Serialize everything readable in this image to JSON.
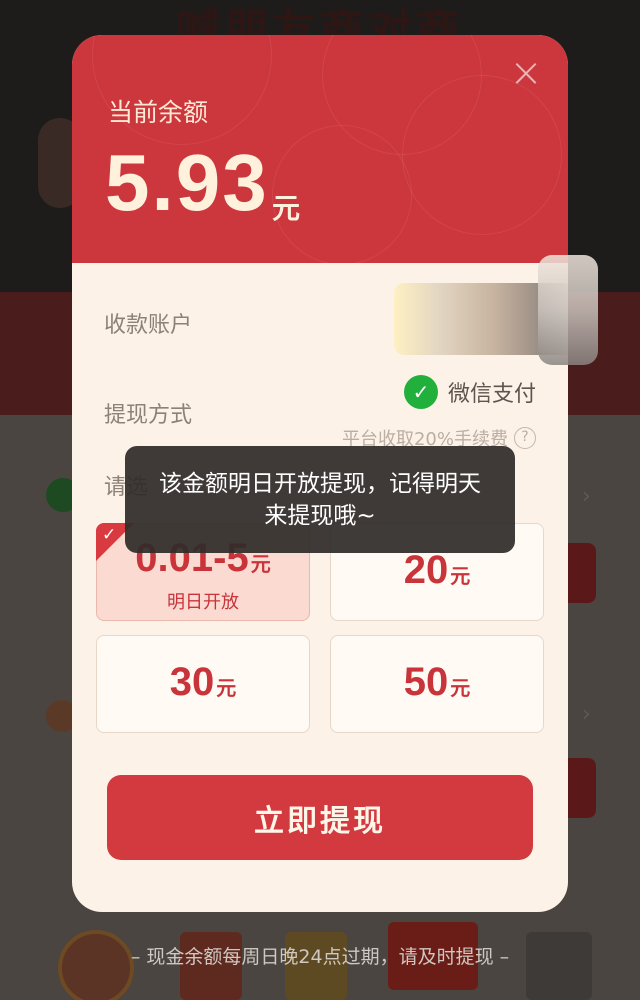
{
  "background": {
    "title": "喊朋友商对商"
  },
  "modal": {
    "balance_label": "当前余额",
    "balance_amount": "5.93",
    "balance_unit": "元",
    "close_symbol": "×",
    "account_label": "收款账户",
    "method_label": "提现方式",
    "method_value": "微信支付",
    "fee_note": "平台收取20%手续费",
    "select_label": "请选",
    "options": [
      {
        "amount": "0.01-5",
        "unit": "元",
        "sub": "明日开放",
        "selected": true
      },
      {
        "amount": "20",
        "unit": "元"
      },
      {
        "amount": "30",
        "unit": "元"
      },
      {
        "amount": "50",
        "unit": "元"
      }
    ],
    "withdraw_button": "立即提现"
  },
  "toast": {
    "message": "该金额明日开放提现，记得明天来提现哦~"
  },
  "footer": {
    "note": "– 现金余额每周日晚24点过期，请及时提现 –"
  },
  "colors": {
    "header_red": "#cc363d",
    "accent_red": "#c9333a",
    "card_bg": "#fcf2e8",
    "wechat_green": "#22b03c"
  },
  "icons": {
    "close": "close-icon",
    "wechat": "wechat-pay-icon",
    "help": "question-circle-icon",
    "check": "checkmark-icon"
  }
}
